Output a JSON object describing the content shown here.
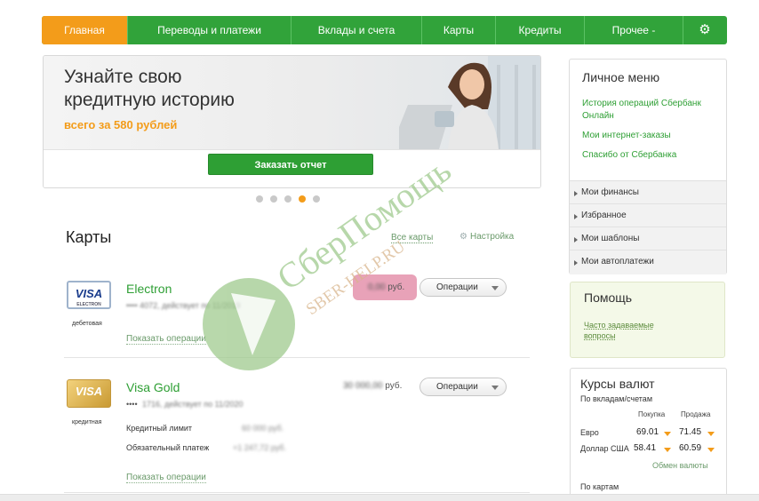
{
  "nav": {
    "items": [
      {
        "label": "Главная"
      },
      {
        "label": "Переводы и платежи"
      },
      {
        "label": "Вклады и счета"
      },
      {
        "label": "Карты"
      },
      {
        "label": "Кредиты"
      },
      {
        "label": "Прочее -"
      }
    ],
    "gear_icon": "gear-icon",
    "active_color": "#f39c1a",
    "bar_color": "#31a33a"
  },
  "banner": {
    "title_line1": "Узнайте свою",
    "title_line2": "кредитную историю",
    "subtitle": "всего за 580 рублей",
    "button_label": "Заказать отчет",
    "slides_total": 5,
    "slide_active": 4
  },
  "cards": {
    "title": "Карты",
    "all_cards_link": "Все карты",
    "settings_link": "Настройка",
    "items": [
      {
        "name": "Electron",
        "logo_text": "VISA",
        "logo_small": "ELECTRON",
        "type": "дебетовая",
        "number_masked": "•••• 4072, действует по 11/2019",
        "balance_value": "0,00",
        "balance_unit": "руб.",
        "ops_label": "Операции",
        "show_ops_label": "Показать операции"
      },
      {
        "name": "Visa Gold",
        "logo_text": "VISA",
        "type": "кредитная",
        "number_prefix": "••••",
        "number_masked": "1716, действует по 11/2020",
        "balance_value": "30 000,00",
        "balance_unit": "руб.",
        "ops_label": "Операции",
        "credit_limit_label": "Кредитный лимит",
        "credit_limit_value": "60 000 руб.",
        "min_payment_label": "Обязательный платеж",
        "min_payment_value": "+1 247,72 руб.",
        "show_ops_label": "Показать операции"
      }
    ]
  },
  "personal_menu": {
    "title": "Личное меню",
    "links": [
      "История операций Сбербанк Онлайн",
      "Мои интернет-заказы",
      "Спасибо от Сбербанка"
    ],
    "items": [
      "Мои финансы",
      "Избранное",
      "Мои шаблоны",
      "Мои автоплатежи"
    ]
  },
  "help": {
    "title": "Помощь",
    "link": "Часто задаваемые вопросы"
  },
  "rates": {
    "title": "Курсы валют",
    "subtitle": "По вкладам/счетам",
    "col_buy": "Покупка",
    "col_sell": "Продажа",
    "rows": [
      {
        "label": "Евро",
        "buy": "69.01",
        "sell": "71.45"
      },
      {
        "label": "Доллар США",
        "buy": "58.41",
        "sell": "60.59"
      }
    ],
    "exchange_link": "Обмен валюты",
    "cards_subtitle": "По картам"
  },
  "watermark": {
    "line1": "СберПомощь",
    "line2": "SBER-HELP.RU"
  }
}
